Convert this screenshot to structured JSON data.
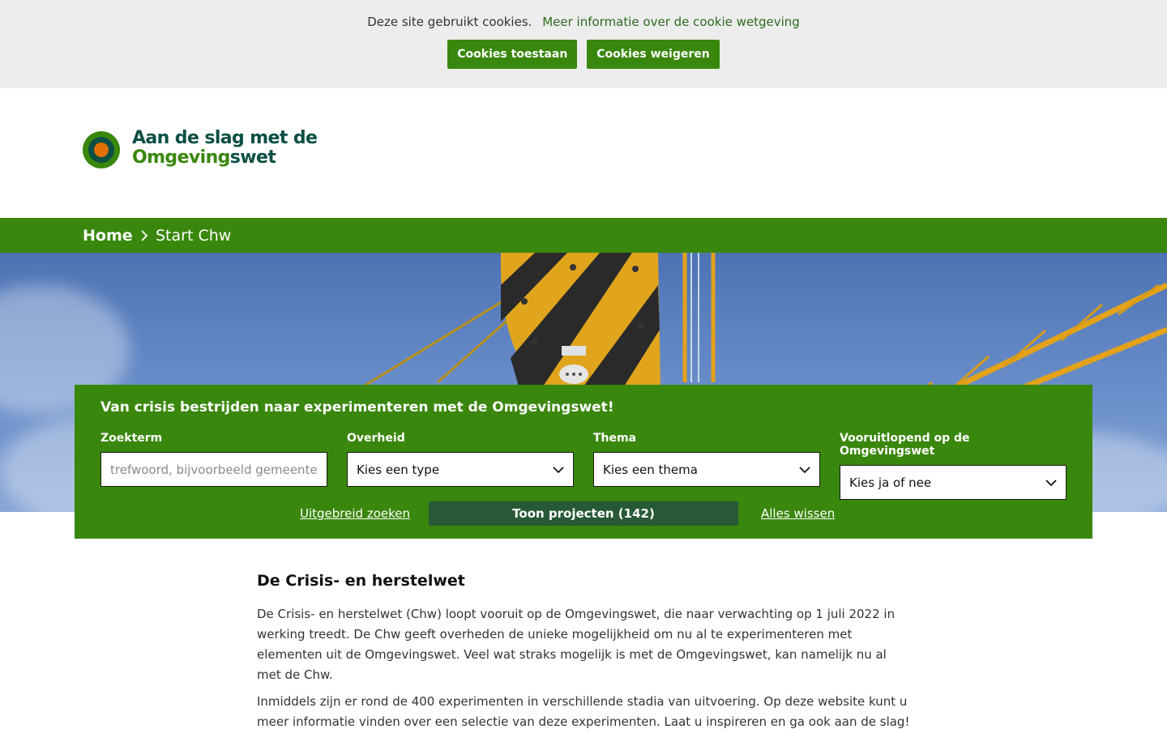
{
  "cookie_bar": {
    "message": "Deze site gebruikt cookies.",
    "info_link": "Meer informatie over de cookie wetgeving",
    "accept_label": "Cookies toestaan",
    "reject_label": "Cookies weigeren"
  },
  "logo": {
    "line1": "Aan de slag met de",
    "line2_a": "Omgeving",
    "line2_b": "swet"
  },
  "breadcrumb": {
    "home": "Home",
    "current": "Start Chw"
  },
  "search": {
    "title": "Van crisis bestrijden naar experimenteren met de Omgevingswet!",
    "fields": [
      {
        "label": "Zoekterm",
        "placeholder": "trefwoord, bijvoorbeeld gemeente"
      },
      {
        "label": "Overheid",
        "value": "Kies een type"
      },
      {
        "label": "Thema",
        "value": "Kies een thema"
      },
      {
        "label": "Vooruitlopend op de Omgevingswet",
        "value": "Kies ja of nee"
      }
    ],
    "advanced_link": "Uitgebreid zoeken",
    "show_button": "Toon projecten (142)",
    "clear_link": "Alles wissen"
  },
  "content": {
    "heading": "De Crisis- en herstelwet",
    "paragraphs": [
      "De Crisis- en herstelwet (Chw) loopt vooruit op de Omgevingswet, die naar verwachting op 1 juli 2022 in werking treedt. De Chw geeft overheden de unieke mogelijkheid om nu al te experimenteren met elementen uit de Omgevingswet. Veel wat straks mogelijk is met de Omgevingswet, kan namelijk nu al met de Chw.",
      "Inmiddels zijn er rond de 400 experimenten in verschillende stadia van uitvoering. Op deze website kunt u meer informatie vinden over een selectie van deze experimenten. Laat u inspireren en ga ook aan de slag!"
    ]
  },
  "colors": {
    "brand_green": "#39870c",
    "dark_green": "#275937",
    "logo_dark": "#0c4f45",
    "logo_orange": "#e17000",
    "cookie_bg": "#ededed"
  },
  "icons": {
    "breadcrumb_separator": "chevron-right-icon",
    "select_arrow": "chevron-down-icon"
  }
}
